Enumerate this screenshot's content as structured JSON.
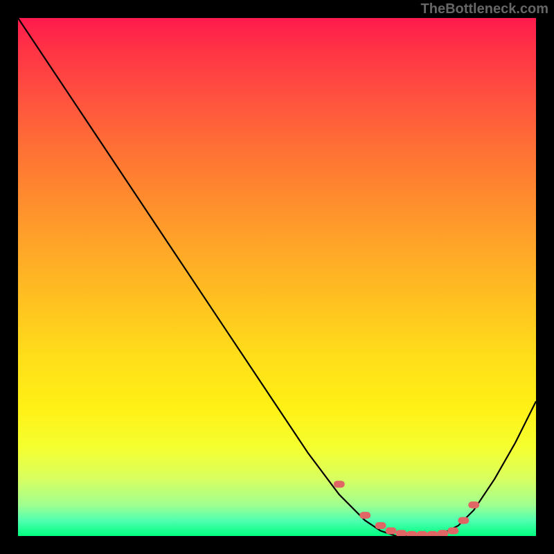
{
  "watermark": "TheBottleneck.com",
  "chart_data": {
    "type": "line",
    "title": "",
    "xlabel": "",
    "ylabel": "",
    "xlim": [
      0,
      100
    ],
    "ylim": [
      0,
      100
    ],
    "series": [
      {
        "name": "bottleneck-curve",
        "x": [
          0,
          10,
          20,
          30,
          40,
          50,
          56,
          62,
          67,
          70,
          73,
          76,
          80,
          82,
          85,
          88,
          92,
          96,
          100
        ],
        "values": [
          100,
          85,
          70,
          55,
          40,
          25,
          16,
          8,
          3,
          1,
          0,
          0,
          0,
          0.5,
          2,
          5,
          11,
          18,
          26
        ]
      }
    ],
    "optimal_markers": {
      "name": "optimal-range",
      "color": "#e06666",
      "x": [
        62,
        67,
        70,
        72,
        74,
        76,
        78,
        80,
        82,
        84,
        86,
        88
      ],
      "values": [
        10,
        4,
        2,
        1,
        0.5,
        0.3,
        0.3,
        0.3,
        0.5,
        1,
        3,
        6
      ]
    },
    "gradient_stops": [
      {
        "pos": 0,
        "color": "#ff1a4d"
      },
      {
        "pos": 50,
        "color": "#ffb020"
      },
      {
        "pos": 80,
        "color": "#ffff20"
      },
      {
        "pos": 100,
        "color": "#00ff80"
      }
    ]
  }
}
